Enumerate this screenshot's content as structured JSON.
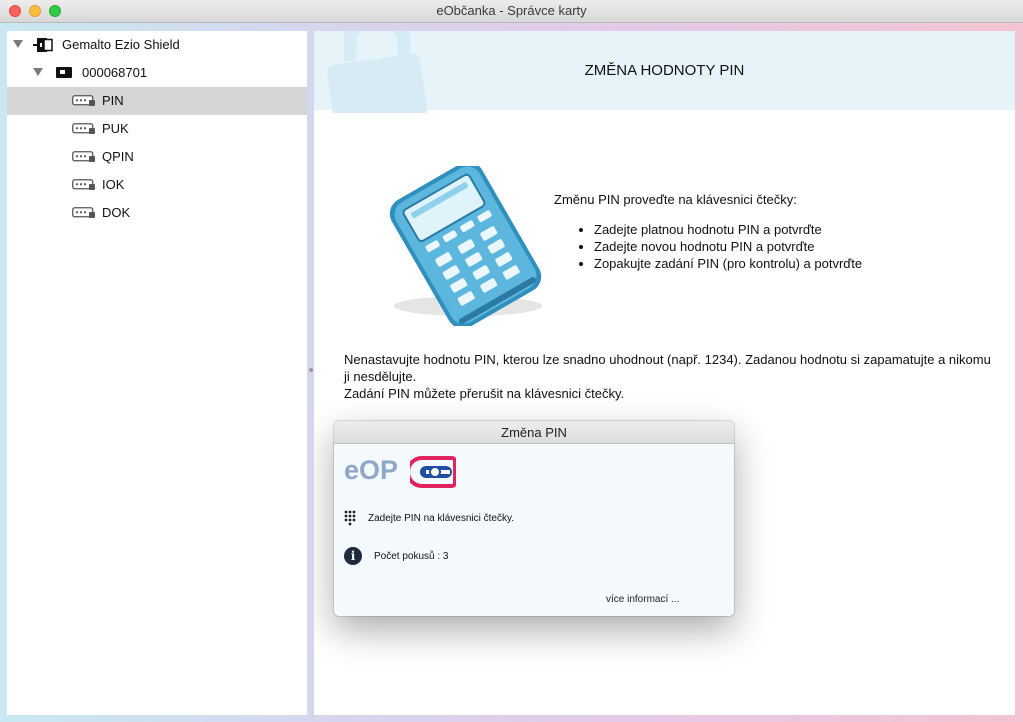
{
  "window": {
    "title": "eObčanka - Správce karty"
  },
  "sidebar": {
    "reader": {
      "label": "Gemalto Ezio Shield",
      "icon": "card-reader-icon"
    },
    "card": {
      "label": "000068701",
      "icon": "smart-card-icon"
    },
    "items": [
      {
        "label": "PIN",
        "icon": "pin-key-icon",
        "selected": true
      },
      {
        "label": "PUK",
        "icon": "pin-key-icon",
        "selected": false
      },
      {
        "label": "QPIN",
        "icon": "pin-key-icon",
        "selected": false
      },
      {
        "label": "IOK",
        "icon": "pin-key-icon",
        "selected": false
      },
      {
        "label": "DOK",
        "icon": "pin-key-icon",
        "selected": false
      }
    ]
  },
  "main": {
    "header": {
      "title": "ZMĚNA HODNOTY PIN",
      "icon": "lock-icon"
    },
    "instructions": {
      "intro": "Změnu PIN proveďte na klávesnici čtečky:",
      "steps": [
        "Zadejte platnou hodnotu PIN a potvrďte",
        "Zadejte novou hodnotu PIN a potvrďte",
        "Zopakujte zadání PIN (pro kontrolu) a potvrďte"
      ]
    },
    "note": {
      "line1": "Nenastavujte hodnotu PIN, kterou lze snadno uhodnout (např. 1234). Zadanou hodnotu si zapamatujte a nikomu ji nesdělujte.",
      "line2": "Zadání PIN můžete přerušit na klávesnici čtečky."
    }
  },
  "dialog": {
    "title": "Změna PIN",
    "logo_text": "eOP",
    "prompt": "Zadejte PIN na klávesnici čtečky.",
    "attempts": "Počet pokusů : 3",
    "more_link": "více informací ..."
  },
  "colors": {
    "banner_bg": "#e6f4fa",
    "selection": "#d6d6d6",
    "logo_blue": "#8fa7ca",
    "logo_red": "#e0245e",
    "logo_navy": "#1f4fa3"
  }
}
